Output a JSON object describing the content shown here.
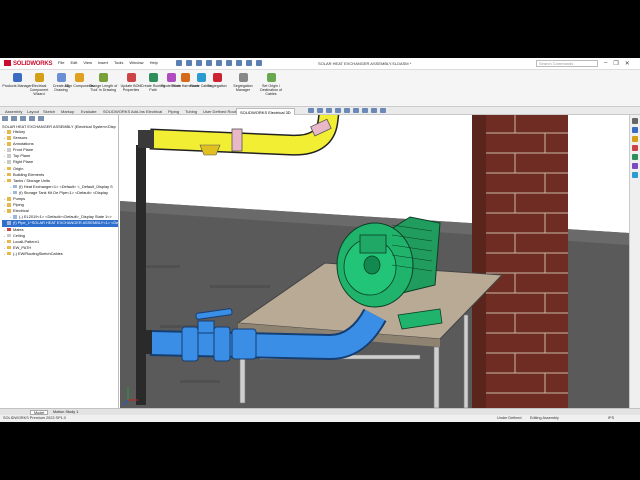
{
  "app": {
    "logo": "SOLIDWORKS",
    "menus": [
      "File",
      "Edit",
      "View",
      "Insert",
      "Tools",
      "Window",
      "Help"
    ],
    "doc_title": "SOLAR HEAT EXCHANGER ASSEMBLY.SLDASM *",
    "search_placeholder": "Search Commands"
  },
  "ribbon": {
    "buttons": [
      {
        "label": "Products Manager",
        "icon": "products-manager-icon",
        "color": "#3b6cc2"
      },
      {
        "label": "Electrical Component Wizard",
        "icon": "electrical-component-wizard-icon",
        "color": "#d4a017"
      },
      {
        "label": "Create 3D Drawing",
        "icon": "create-drawing-icon",
        "color": "#6b8ed6"
      },
      {
        "label": "Align Components",
        "icon": "align-components-icon",
        "color": "#e0a020"
      },
      {
        "label": "Change Length of 'Tool' in Drawing",
        "icon": "change-length-icon",
        "color": "#7aa03c"
      },
      {
        "label": "Update BOM Properties",
        "icon": "update-bom-icon",
        "color": "#c44"
      },
      {
        "label": "Create Routing Path",
        "icon": "routing-path-icon",
        "color": "#2f8f5b"
      },
      {
        "label": "Route Wires",
        "icon": "route-wires-icon",
        "color": "#b04bc0"
      },
      {
        "label": "Route Harnesses",
        "icon": "route-harnesses-icon",
        "color": "#d46a1a"
      },
      {
        "label": "Route Cables",
        "icon": "route-cables-icon",
        "color": "#2b9bd1"
      },
      {
        "label": "Segregation",
        "icon": "segregation-icon",
        "color": "#c23"
      },
      {
        "label": "Segregation Manager",
        "icon": "segregation-manager-icon",
        "color": "#888"
      },
      {
        "label": "Set Origin / Destination of Cables",
        "icon": "origin-destination-icon",
        "color": "#6aa84f"
      }
    ]
  },
  "tabs": [
    "Assembly",
    "Layout",
    "Sketch",
    "Markup",
    "Evaluate",
    "SOLIDWORKS Add-Ins",
    "Electrical",
    "Piping",
    "Tubing",
    "User Defined Route",
    "SOLIDWORKS Electrical 3D"
  ],
  "active_tab": "SOLIDWORKS Electrical 3D",
  "tree": {
    "root": "SOLAR HEAT EXCHANGER ASSEMBLY (Electrical System<Disp",
    "items": [
      {
        "label": "History",
        "level": 1,
        "icon": "history-icon"
      },
      {
        "label": "Sensors",
        "level": 1,
        "icon": "sensors-icon"
      },
      {
        "label": "Annotations",
        "level": 1,
        "icon": "annotations-icon"
      },
      {
        "label": "Front Plane",
        "level": 1,
        "icon": "plane-icon"
      },
      {
        "label": "Top Plane",
        "level": 1,
        "icon": "plane-icon"
      },
      {
        "label": "Right Plane",
        "level": 1,
        "icon": "plane-icon"
      },
      {
        "label": "Origin",
        "level": 1,
        "icon": "origin-icon"
      },
      {
        "label": "Building Elements",
        "level": 1,
        "icon": "folder-icon"
      },
      {
        "label": "Tanks / Storage Units",
        "level": 1,
        "icon": "folder-icon"
      },
      {
        "label": "(f) Heat Exchanger<1> <Default> <_Default_Display S",
        "level": 2,
        "icon": "part-icon"
      },
      {
        "label": "(f) Storage Tank Kit De Pipe<1> <Default> <Display",
        "level": 2,
        "icon": "part-icon"
      },
      {
        "label": "Pumps",
        "level": 1,
        "icon": "folder-icon"
      },
      {
        "label": "Piping",
        "level": 1,
        "icon": "folder-icon"
      },
      {
        "label": "Electrical",
        "level": 1,
        "icon": "folder-icon"
      },
      {
        "label": "(-) EL2019<1> <Default><Default>_Display State 1<>",
        "level": 2,
        "icon": "part-icon"
      },
      {
        "label": "(f) Pipe_1^SOLAR HEAT EXCHANGER ASSEMBLY<1> <De",
        "level": 1,
        "icon": "part-icon",
        "selected": true
      },
      {
        "label": "Mates",
        "level": 1,
        "icon": "mates-icon"
      },
      {
        "label": "Ceiling",
        "level": 1,
        "icon": "plane-icon"
      },
      {
        "label": "LocalLPattern1",
        "level": 1,
        "icon": "pattern-icon"
      },
      {
        "label": "EW_PATH",
        "level": 1,
        "icon": "folder-icon"
      },
      {
        "label": "(-) EW/RoutingSketchCables",
        "level": 1,
        "icon": "sketch-icon"
      }
    ]
  },
  "bottom_tabs": [
    "Model",
    "Motion Study 1"
  ],
  "active_bottom_tab": "Model",
  "status": {
    "version": "SOLIDWORKS Premium 2023 SP1.0",
    "state": "Under Defined",
    "mode": "Editing Assembly",
    "units": "IPS"
  },
  "colors": {
    "pipe_blue": "#3a8ee6",
    "pipe_yellow": "#f2ee34",
    "pump_green": "#1fb36b",
    "brick": "#7a2f24",
    "selection": "#2f6fce"
  }
}
